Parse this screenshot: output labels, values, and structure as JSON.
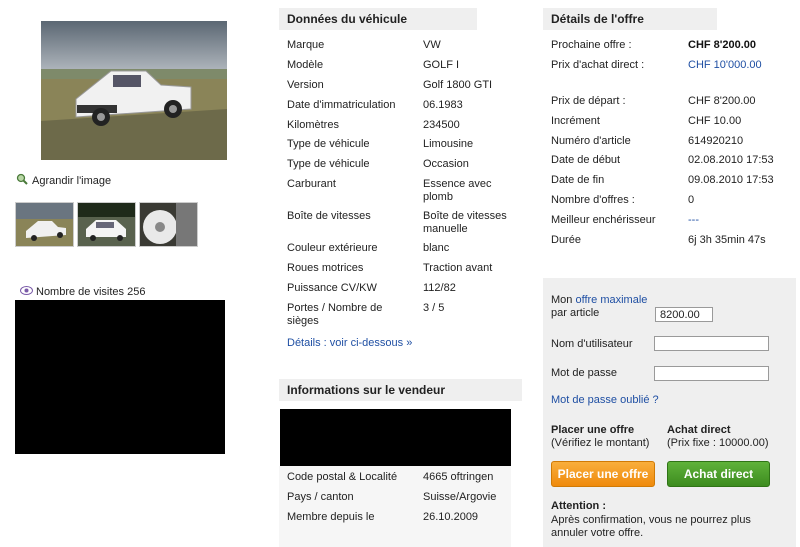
{
  "left": {
    "enlarge_label": "Agrandir l'image",
    "visits_label": "Nombre de visites 256"
  },
  "vehicle": {
    "header": "Données du véhicule",
    "rows": [
      {
        "label": "Marque",
        "value": "VW"
      },
      {
        "label": "Modèle",
        "value": "GOLF I"
      },
      {
        "label": "Version",
        "value": "Golf 1800 GTI"
      },
      {
        "label": "Date d'immatriculation",
        "value": "06.1983"
      },
      {
        "label": "Kilomètres",
        "value": "234500"
      },
      {
        "label": "Type de véhicule",
        "value": "Limousine"
      },
      {
        "label": "Type de véhicule",
        "value": "Occasion"
      },
      {
        "label": "Carburant",
        "value": "Essence avec plomb"
      },
      {
        "label": "Boîte de vitesses",
        "value": "Boîte de vitesses manuelle"
      },
      {
        "label": "Couleur extérieure",
        "value": "blanc"
      },
      {
        "label": "Roues motrices",
        "value": "Traction avant"
      },
      {
        "label": "Puissance CV/KW",
        "value": "112/82"
      },
      {
        "label": "Portes / Nombre de sièges",
        "value": "3 / 5"
      }
    ],
    "details_link": "Détails : voir ci-dessous »"
  },
  "seller": {
    "header": "Informations sur le vendeur",
    "rows": [
      {
        "label": "Code postal & Localité",
        "value": "4665 oftringen"
      },
      {
        "label": "Pays / canton",
        "value": "Suisse/Argovie"
      },
      {
        "label": "Membre depuis le",
        "value": "26.10.2009"
      }
    ]
  },
  "offer": {
    "header": "Détails de l'offre",
    "next_offer_label": "Prochaine offre :",
    "next_offer_value": "CHF 8'200.00",
    "buy_now_label": "Prix d'achat direct :",
    "buy_now_value": "CHF 10'000.00",
    "rows": [
      {
        "label": "Prix de départ :",
        "value": "CHF 8'200.00"
      },
      {
        "label": "Incrément",
        "value": "CHF 10.00"
      },
      {
        "label": "Numéro d'article",
        "value": "614920210"
      },
      {
        "label": "Date de début",
        "value": "02.08.2010 17:53"
      },
      {
        "label": "Date de fin",
        "value": "09.08.2010 17:53"
      },
      {
        "label": "Nombre d'offres :",
        "value": "0"
      },
      {
        "label": "Meilleur enchérisseur",
        "value": "---"
      },
      {
        "label": "Durée",
        "value": "6j 3h 35min 47s"
      }
    ]
  },
  "bid": {
    "my_label": "Mon",
    "max_offer_link": "offre maximale",
    "per_item": "par article",
    "max_offer_value": "8200.00",
    "username_label": "Nom d'utilisateur",
    "password_label": "Mot de passe",
    "forgot_link": "Mot de passe oublié ?",
    "place_title": "Placer une offre",
    "place_sub": "(Vérifiez le montant)",
    "buy_title": "Achat direct",
    "buy_sub": "(Prix fixe : 10000.00)",
    "place_button": "Placer une offre",
    "buy_button": "Achat direct",
    "attention_title": "Attention :",
    "attention_text": "Après confirmation, vous ne pourrez plus annuler votre offre."
  },
  "colors": {
    "link": "#1f4fa3",
    "orange_button": "#ef8a0c",
    "green_button": "#3d8c1f"
  }
}
